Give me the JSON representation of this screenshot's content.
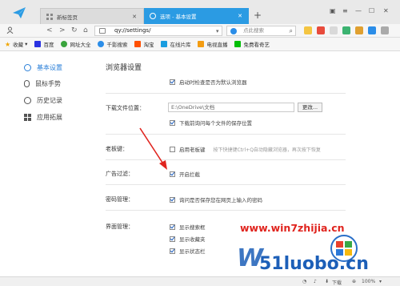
{
  "tabs": [
    {
      "label": "新标签页",
      "active": false
    },
    {
      "label": "选项 - 基本设置",
      "active": true
    }
  ],
  "nav": {
    "address": "qy://settings/",
    "search_placeholder": "点此搜索"
  },
  "bookmarks": [
    {
      "label": "收藏",
      "icon": "star-icon"
    },
    {
      "label": "百度",
      "icon": "baidu-icon"
    },
    {
      "label": "网址大全",
      "icon": "globe-icon"
    },
    {
      "label": "千影搜索",
      "icon": "search-icon"
    },
    {
      "label": "淘宝",
      "icon": "taobao-icon"
    },
    {
      "label": "在线片库",
      "icon": "film-icon"
    },
    {
      "label": "电视直播",
      "icon": "tv-icon"
    },
    {
      "label": "免费看奇艺",
      "icon": "play-icon"
    }
  ],
  "sidebar": {
    "items": [
      {
        "label": "基本设置",
        "icon": "settings-icon",
        "active": true
      },
      {
        "label": "鼠标手势",
        "icon": "mouse-icon",
        "active": false
      },
      {
        "label": "历史记录",
        "icon": "clock-icon",
        "active": false
      },
      {
        "label": "应用拓展",
        "icon": "apps-icon",
        "active": false
      }
    ]
  },
  "settings": {
    "title": "浏览器设置",
    "default_browser_check": "启动时检查是否为默认浏览器",
    "download_label": "下载文件位置：",
    "download_path": "E:\\OneDrive\\文档",
    "change_button": "更改...",
    "ask_each_download": "下载前询问每个文件的保存位置",
    "boss_key_label": "老板键：",
    "boss_key_option": "启用老板键",
    "boss_key_hint": "按下快捷键Ctrl+Q自动隐藏浏览器，再次按下恢复",
    "adfilter_label": "广告过滤：",
    "adfilter_option": "开启拦截",
    "password_label": "密码管理：",
    "password_option": "询问是否保存您在网页上输入的密码",
    "ui_label": "界面管理：",
    "ui_options": [
      "显示搜索框",
      "显示收藏夹",
      "显示状态栏"
    ]
  },
  "watermark": {
    "url": "www.win7zhijia.cn",
    "logo": "51luobo.cn"
  },
  "statusbar": {
    "download": "下载",
    "zoom": "100%"
  },
  "colors": {
    "accent": "#2b9be3",
    "watermark_red": "#e0241e",
    "watermark_blue": "#1c5fb8"
  }
}
